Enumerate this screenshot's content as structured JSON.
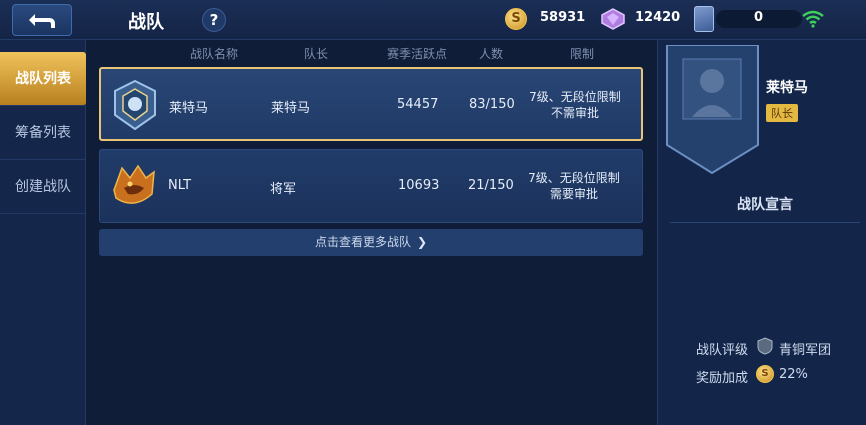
{
  "header": {
    "title": "战队",
    "help_label": "?",
    "gold": "58931",
    "gems": "12420",
    "cards": "0"
  },
  "sidebar": {
    "items": [
      {
        "label": "战队列表",
        "active": true
      },
      {
        "label": "筹备列表",
        "active": false
      },
      {
        "label": "创建战队",
        "active": false
      }
    ]
  },
  "table": {
    "columns": [
      "战队名称",
      "队长",
      "赛季活跃点",
      "人数",
      "限制"
    ],
    "rows": [
      {
        "name": "莱特马",
        "leader": "莱特马",
        "activity": "54457",
        "members": "83/150",
        "limit_line1": "7级、无段位限制",
        "limit_line2": "不需审批",
        "selected": true
      },
      {
        "name": "NLT",
        "leader": "将军",
        "activity": "10693",
        "members": "21/150",
        "limit_line1": "7级、无段位限制",
        "limit_line2": "需要审批",
        "selected": false
      }
    ],
    "more_label": "点击查看更多战队"
  },
  "detail": {
    "leader_name": "莱特马",
    "leader_badge": "队长",
    "manifesto_title": "战队宣言",
    "rating_label": "战队评级",
    "rating_value": "青铜军团",
    "bonus_label": "奖励加成",
    "bonus_value": "22%"
  },
  "colors": {
    "accent_gold": "#e8c477",
    "background": "#0f1d38",
    "panel": "#1b325b",
    "wifi": "#3ecf5a"
  },
  "icons": [
    "back-icon",
    "help-icon",
    "gold-coin-icon",
    "gem-icon",
    "card-icon",
    "wifi-icon",
    "team-emblem-icon",
    "chevron-right-icon",
    "rank-shield-icon"
  ]
}
